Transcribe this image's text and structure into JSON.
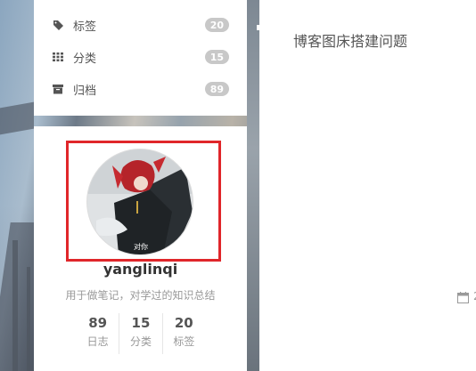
{
  "menu": {
    "items": [
      {
        "icon": "tags-icon",
        "label": "标签",
        "count": "20"
      },
      {
        "icon": "grid-icon",
        "label": "分类",
        "count": "15"
      },
      {
        "icon": "archive-icon",
        "label": "归档",
        "count": "89"
      }
    ]
  },
  "profile": {
    "name": "yanglinqi",
    "description": "用于做笔记，对学过的知识总结",
    "avatar_caption": "对你",
    "frame_color": "#e0262a",
    "stats": [
      {
        "count": "89",
        "label": "日志"
      },
      {
        "count": "15",
        "label": "分类"
      },
      {
        "count": "20",
        "label": "标签"
      }
    ]
  },
  "post": {
    "title": "博客图床搭建问题",
    "meta_icon": "calendar-icon",
    "meta_text": "2"
  }
}
